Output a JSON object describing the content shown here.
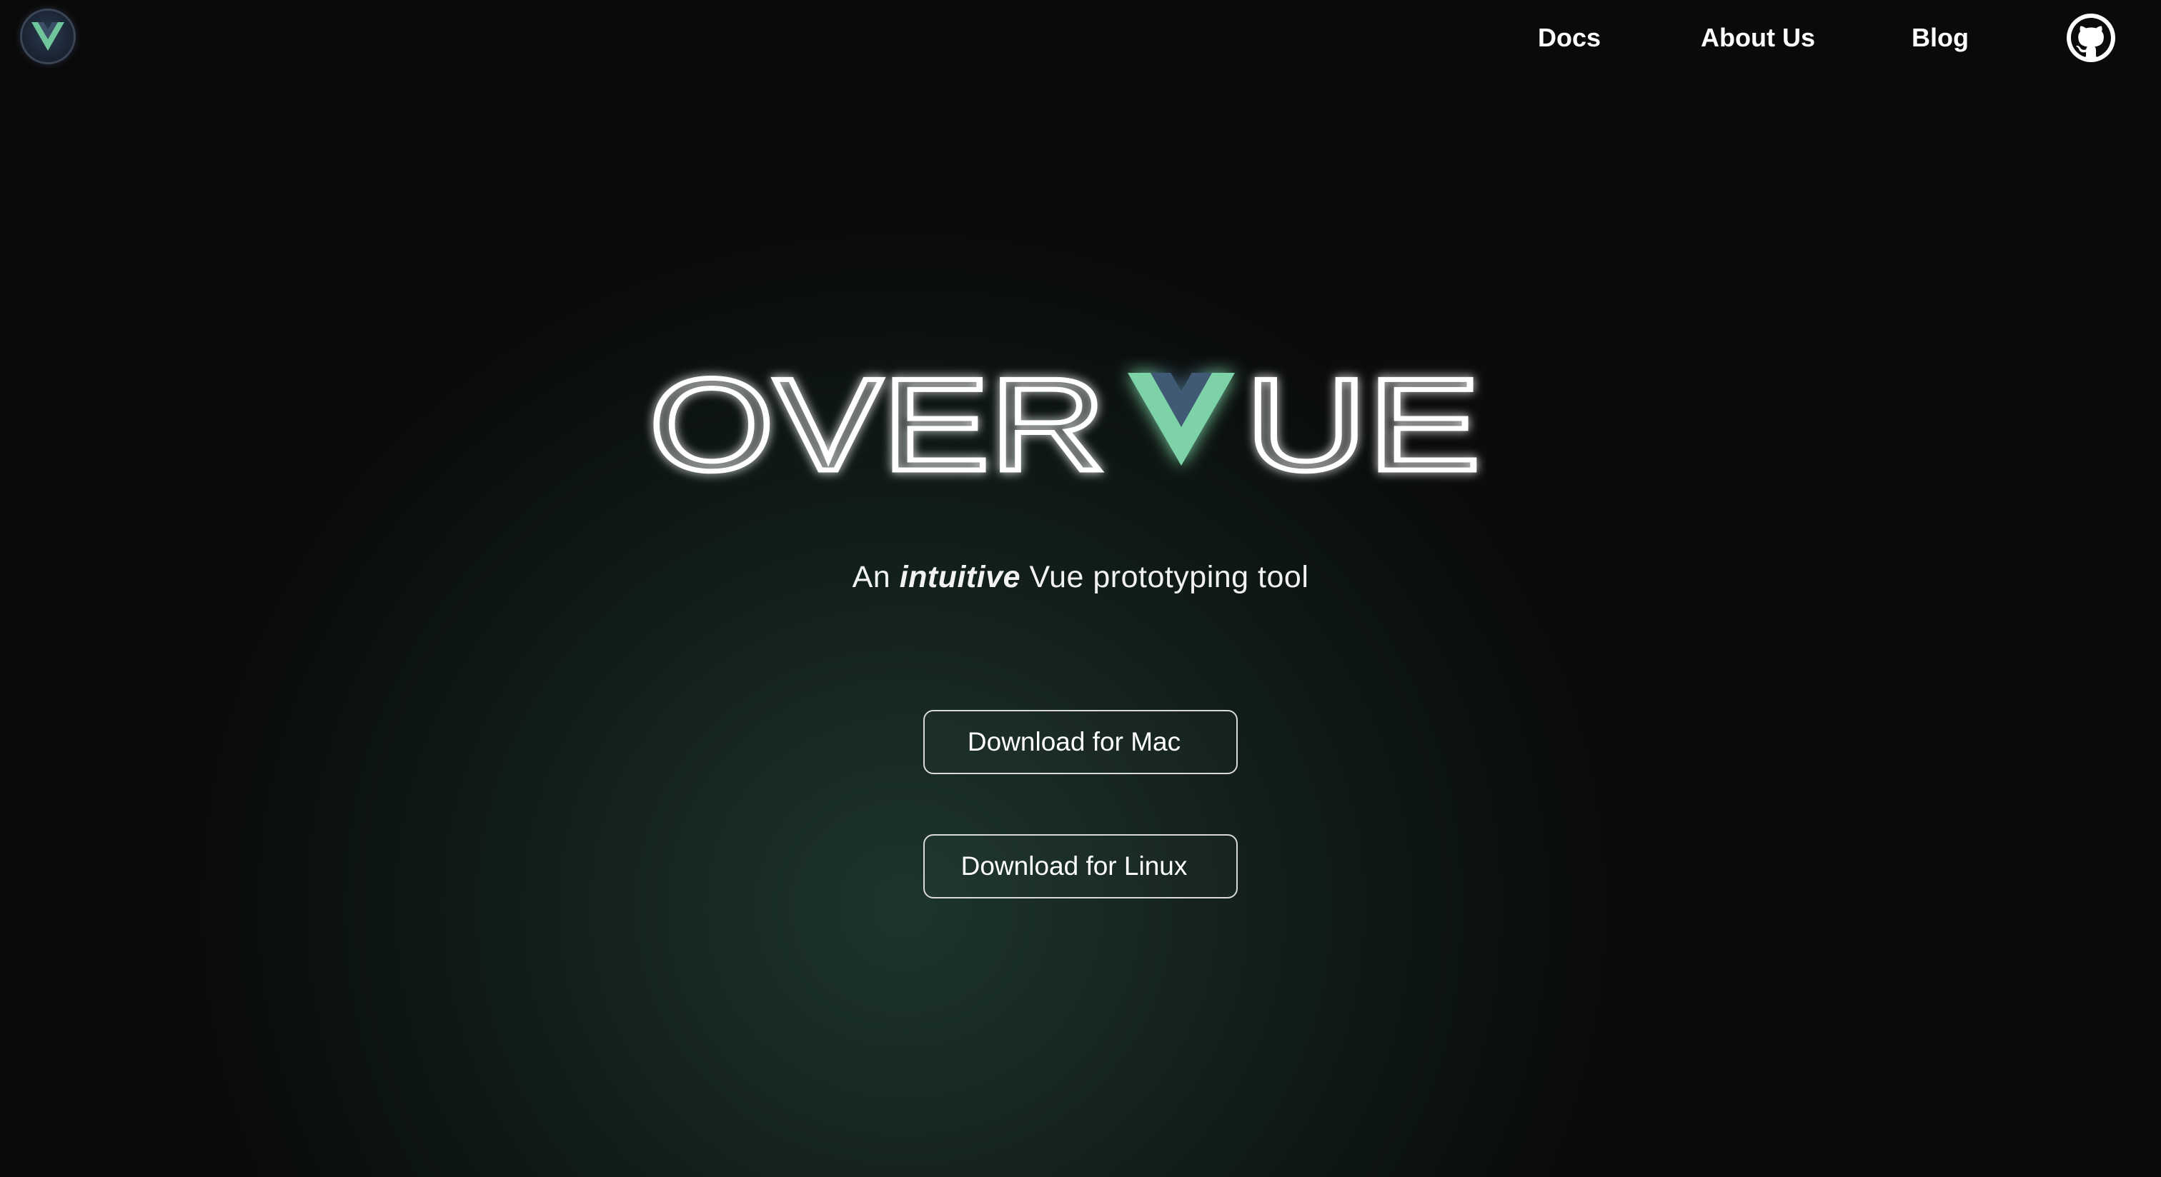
{
  "nav": {
    "logo_icon": "vue-v-logo-icon",
    "links": [
      {
        "label": "Docs"
      },
      {
        "label": "About Us"
      },
      {
        "label": "Blog"
      }
    ],
    "github_icon": "github-icon"
  },
  "hero": {
    "logo_text_left": "OVER",
    "logo_text_right": "UE",
    "logo_mark": "vue-v-icon",
    "tagline_prefix": "An",
    "tagline_emphasis": "intuitive",
    "tagline_suffix": "Vue prototyping tool"
  },
  "buttons": {
    "mac": "Download for Mac",
    "linux": "Download for Linux"
  },
  "colors": {
    "vue_green": "#7ed2a8",
    "vue_dark": "#3f5a74",
    "background_glow": "#1d352b",
    "background_edge": "#0a0a0a"
  }
}
